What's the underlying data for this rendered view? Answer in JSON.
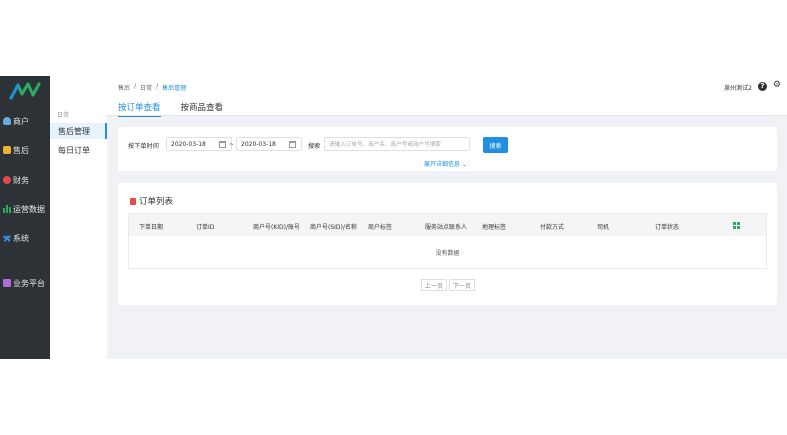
{
  "nav": {
    "items": [
      {
        "label": "商户",
        "icon": "user-icon",
        "color": "#6aa9e0"
      },
      {
        "label": "售后",
        "icon": "service-icon",
        "color": "#f0b030"
      },
      {
        "label": "财务",
        "icon": "finance-icon",
        "color": "#e5474b"
      },
      {
        "label": "运营数据",
        "icon": "bar-chart-icon",
        "color": "#27ae60"
      },
      {
        "label": "系统",
        "icon": "gear-icon",
        "color": "#3a8ee6"
      },
      {
        "label": "业务平台",
        "icon": "platform-icon",
        "color": "#b36bd6"
      }
    ]
  },
  "subnav": {
    "group": "日常",
    "items": [
      {
        "label": "售后管理",
        "active": true
      },
      {
        "label": "每日订单",
        "active": false
      }
    ]
  },
  "header": {
    "breadcrumb": [
      "售后",
      "日常",
      "售后管理"
    ],
    "tabs": [
      "按订单查看",
      "按商品查看"
    ],
    "user": "泉州测试2"
  },
  "search": {
    "time_label": "按下单时间",
    "date_from": "2020-03-18",
    "date_sep": "~",
    "date_to": "2020-03-18",
    "kw_label": "搜索",
    "kw_placeholder": "请输入订单号、商户名、商户号或商户号搜索",
    "search_button": "搜索",
    "expand_label": "展开详细信息"
  },
  "orders": {
    "title": "订单列表",
    "columns": [
      "下单日期",
      "订单ID",
      "商户号(KID)/账号",
      "商户号(SID)/名称",
      "商户标签",
      "服务站点联系人",
      "地理标签",
      "付款方式",
      "司机",
      "订单状态"
    ],
    "empty_text": "没有数据",
    "pager": {
      "prev": "上一页",
      "next": "下一页"
    }
  },
  "colors": {
    "accent": "#1e8fe1",
    "nav_bg": "#2d3237"
  }
}
